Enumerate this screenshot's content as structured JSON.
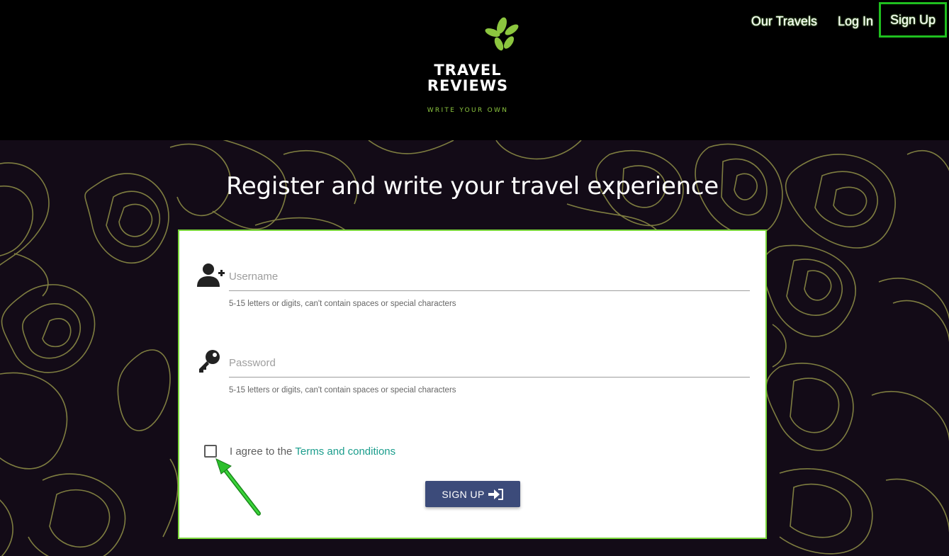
{
  "brand": {
    "line1": "TRAVEL",
    "line2": "REVIEWS",
    "tagline": "WRITE YOUR OWN",
    "leaf_color": "#8cc63f"
  },
  "nav": {
    "items": [
      {
        "label": "Our Travels"
      },
      {
        "label": "Log In"
      },
      {
        "label": "Sign Up"
      }
    ],
    "active_border_color": "#1fbf1f"
  },
  "page": {
    "headline": "Register and write your travel experience"
  },
  "form": {
    "username": {
      "placeholder": "Username",
      "hint": "5-15 letters or digits, can't contain spaces or special characters",
      "icon": "user-plus-icon"
    },
    "password": {
      "placeholder": "Password",
      "hint": "5-15 letters or digits, can't contain spaces or special characters",
      "icon": "key-icon"
    },
    "agree": {
      "text": "I agree to the",
      "link": "Terms and conditions",
      "checked": false
    },
    "submit": {
      "label": "SIGN UP",
      "icon": "sign-in-icon",
      "color": "#3c4b7a"
    },
    "card_border_color": "#7ad63a"
  },
  "annotation": {
    "arrow_color": "#22b022",
    "icon": "pointer-arrow-icon"
  }
}
